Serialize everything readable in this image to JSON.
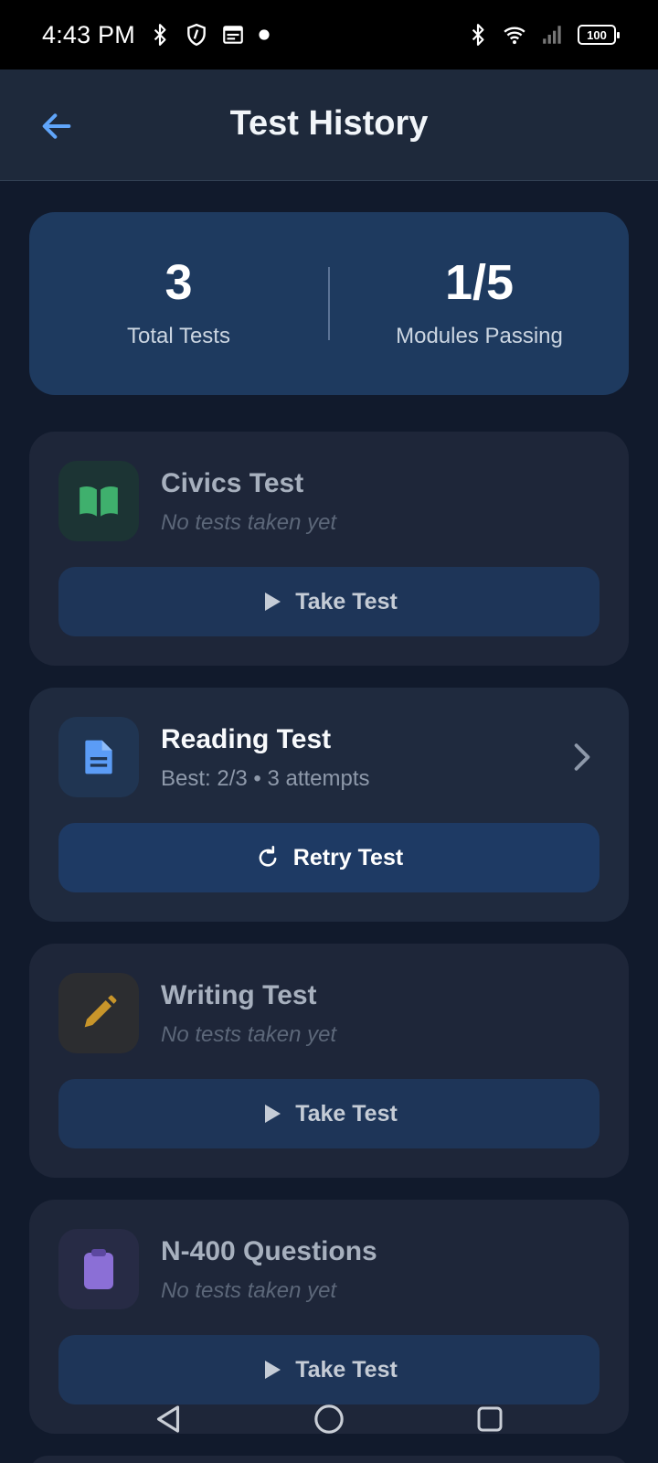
{
  "status_bar": {
    "time": "4:43 PM",
    "battery": "100",
    "icons": [
      "bluetooth-icon",
      "shield-icon",
      "calendar-icon",
      "dot-icon",
      "bluetooth-icon",
      "wifi-icon",
      "signal-icon",
      "battery-icon"
    ]
  },
  "app_bar": {
    "title": "Test History",
    "back_icon": "arrow-left-icon"
  },
  "summary": {
    "total_tests_value": "3",
    "total_tests_label": "Total Tests",
    "modules_passing_value": "1/5",
    "modules_passing_label": "Modules Passing"
  },
  "modules": [
    {
      "title": "Civics Test",
      "subtitle": "No tests taken yet",
      "icon": "book-icon",
      "icon_color": "#3fb06d",
      "icon_bg": "#1c3434",
      "button_label": "Take Test",
      "button_icon": "play-icon"
    },
    {
      "title": "Reading Test",
      "subtitle": "Best: 2/3 • 3 attempts",
      "icon": "document-icon",
      "icon_color": "#5b9cf6",
      "icon_bg": "#203552",
      "button_label": "Retry Test",
      "button_icon": "refresh-icon"
    },
    {
      "title": "Writing Test",
      "subtitle": "No tests taken yet",
      "icon": "pencil-icon",
      "icon_color": "#c8952a",
      "icon_bg": "#2c2d30",
      "button_label": "Take Test",
      "button_icon": "play-icon"
    },
    {
      "title": "N-400 Questions",
      "subtitle": "No tests taken yet",
      "icon": "clipboard-icon",
      "icon_color": "#8b6fd6",
      "icon_bg": "#272b45",
      "button_label": "Take Test",
      "button_icon": "play-icon"
    }
  ],
  "colors": {
    "background": "#111a2c",
    "card": "#1e2639",
    "summary_card": "#1e3a5f",
    "accent_blue": "#5b9cf6"
  },
  "nav_bar": [
    "back-triangle-icon",
    "home-circle-icon",
    "recents-square-icon"
  ]
}
